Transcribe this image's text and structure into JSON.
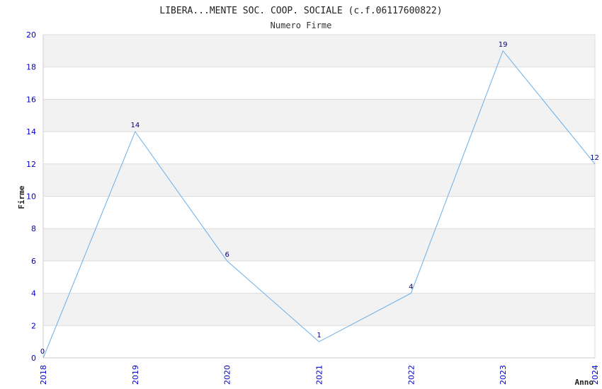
{
  "chart_data": {
    "type": "line",
    "title": "LIBERA...MENTE SOC. COOP. SOCIALE (c.f.06117600822)",
    "subtitle": "Numero Firme",
    "xlabel": "Anno",
    "ylabel": "Firme",
    "x": [
      "2018",
      "2019",
      "2020",
      "2021",
      "2022",
      "2023",
      "2024"
    ],
    "series": [
      {
        "values": [
          0,
          14,
          6,
          1,
          4,
          19,
          12
        ]
      }
    ],
    "ylim": [
      0,
      20
    ],
    "yticks": [
      0,
      2,
      4,
      6,
      8,
      10,
      12,
      14,
      16,
      18,
      20
    ],
    "grid": true,
    "colors": {
      "line": "#6aaee8",
      "band": "#f2f2f2",
      "tick_text": "#0000cc",
      "data_label": "#000080"
    }
  }
}
